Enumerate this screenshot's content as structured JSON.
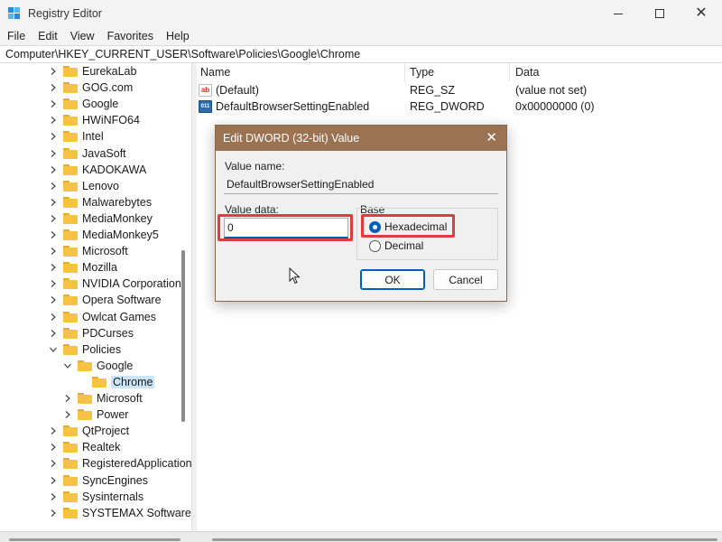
{
  "window": {
    "title": "Registry Editor"
  },
  "menu": [
    "File",
    "Edit",
    "View",
    "Favorites",
    "Help"
  ],
  "address": "Computer\\HKEY_CURRENT_USER\\Software\\Policies\\Google\\Chrome",
  "tree": [
    {
      "label": "EurekaLab",
      "level": 0,
      "expanded": false
    },
    {
      "label": "GOG.com",
      "level": 0,
      "expanded": false
    },
    {
      "label": "Google",
      "level": 0,
      "expanded": false
    },
    {
      "label": "HWiNFO64",
      "level": 0,
      "expanded": false
    },
    {
      "label": "Intel",
      "level": 0,
      "expanded": false
    },
    {
      "label": "JavaSoft",
      "level": 0,
      "expanded": false
    },
    {
      "label": "KADOKAWA",
      "level": 0,
      "expanded": false
    },
    {
      "label": "Lenovo",
      "level": 0,
      "expanded": false
    },
    {
      "label": "Malwarebytes",
      "level": 0,
      "expanded": false
    },
    {
      "label": "MediaMonkey",
      "level": 0,
      "expanded": false
    },
    {
      "label": "MediaMonkey5",
      "level": 0,
      "expanded": false
    },
    {
      "label": "Microsoft",
      "level": 0,
      "expanded": false
    },
    {
      "label": "Mozilla",
      "level": 0,
      "expanded": false
    },
    {
      "label": "NVIDIA Corporation",
      "level": 0,
      "expanded": false
    },
    {
      "label": "Opera Software",
      "level": 0,
      "expanded": false
    },
    {
      "label": "Owlcat Games",
      "level": 0,
      "expanded": false
    },
    {
      "label": "PDCurses",
      "level": 0,
      "expanded": false
    },
    {
      "label": "Policies",
      "level": 0,
      "expanded": true
    },
    {
      "label": "Google",
      "level": 1,
      "expanded": true
    },
    {
      "label": "Chrome",
      "level": 2,
      "expanded": null,
      "selected": true
    },
    {
      "label": "Microsoft",
      "level": 1,
      "expanded": false
    },
    {
      "label": "Power",
      "level": 1,
      "expanded": false
    },
    {
      "label": "QtProject",
      "level": 0,
      "expanded": false
    },
    {
      "label": "Realtek",
      "level": 0,
      "expanded": false
    },
    {
      "label": "RegisteredApplication",
      "level": 0,
      "expanded": false
    },
    {
      "label": "SyncEngines",
      "level": 0,
      "expanded": false
    },
    {
      "label": "Sysinternals",
      "level": 0,
      "expanded": false
    },
    {
      "label": "SYSTEMAX Software",
      "level": 0,
      "expanded": false
    }
  ],
  "columns": {
    "name": "Name",
    "type": "Type",
    "data": "Data"
  },
  "values": [
    {
      "icon": "ab",
      "name": "(Default)",
      "type": "REG_SZ",
      "data": "(value not set)"
    },
    {
      "icon": "011",
      "name": "DefaultBrowserSettingEnabled",
      "type": "REG_DWORD",
      "data": "0x00000000 (0)"
    }
  ],
  "dialog": {
    "title": "Edit DWORD (32-bit) Value",
    "value_name_label": "Value name:",
    "value_name": "DefaultBrowserSettingEnabled",
    "value_data_label": "Value data:",
    "value_data": "0",
    "base_label": "Base",
    "hex_label": "Hexadecimal",
    "dec_label": "Decimal",
    "selected_base": "Hexadecimal",
    "ok": "OK",
    "cancel": "Cancel"
  },
  "colors": {
    "dialog_title_bar": "#9b7352",
    "highlight_box": "#e23b3b",
    "accent": "#005fb8"
  }
}
